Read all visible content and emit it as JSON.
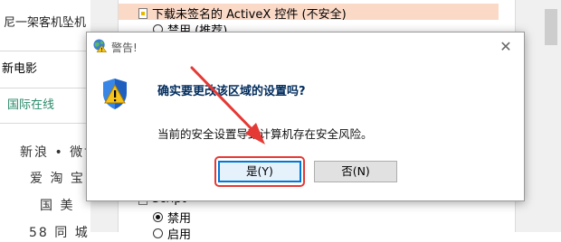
{
  "left_page": {
    "header": "尼一架客机坠机",
    "tab_movie": "新电影",
    "tab_online": "国际在线",
    "links": [
      "新浪 • 微博",
      "爱 淘 宝",
      "国 美",
      "58 同 城"
    ]
  },
  "settings": {
    "item_label": "下载未签名的 ActiveX 控件 (不安全)",
    "opt_disable_recommended": "禁用 (推荐)",
    "partial_label": "Script",
    "opt_disable": "禁用",
    "opt_enable": "启用"
  },
  "dialog": {
    "title": "警告!",
    "main_message": "确实要更改该区域的设置吗?",
    "sub_message": "当前的安全设置导致计算机存在安全风险。",
    "yes_label": "是(Y)",
    "no_label": "否(N)",
    "close_glyph": "✕"
  },
  "colors": {
    "highlight": "#e53935",
    "selected_row": "#fbd9c7",
    "heading_text": "#002b5c"
  },
  "icons": [
    "globe-warning-icon",
    "shield-warning-icon",
    "close-icon",
    "setting-item-icon"
  ]
}
